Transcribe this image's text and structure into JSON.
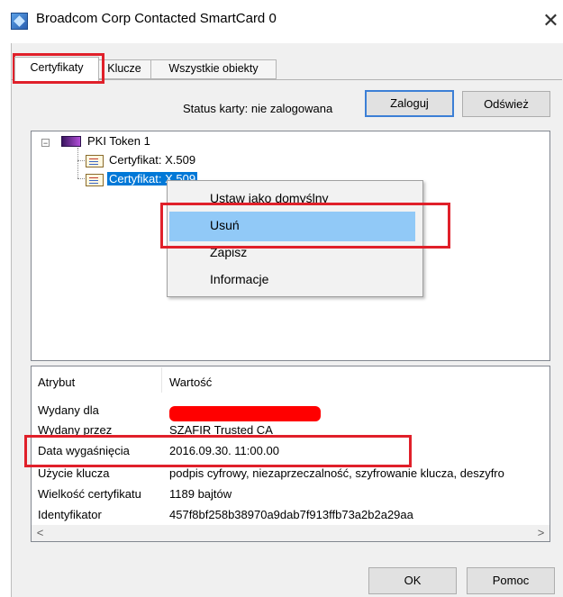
{
  "window": {
    "title": "Broadcom Corp Contacted SmartCard 0",
    "close_glyph": "✕"
  },
  "tabs": [
    "Certyfikaty",
    "Klucze",
    "Wszystkie obiekty"
  ],
  "toolbar": {
    "status_label": "Status karty: nie zalogowana",
    "login_button": "Zaloguj",
    "refresh_button": "Odśwież"
  },
  "tree": {
    "toggle_glyph": "−",
    "root_label": "PKI Token 1",
    "items": [
      "Certyfikat: X.509",
      "Certyfikat: X.509"
    ]
  },
  "context_menu": {
    "items": [
      "Ustaw jako domyślny",
      "Usuń",
      "Zapisz",
      "Informacje"
    ],
    "highlighted": "Usuń"
  },
  "details": {
    "columns": [
      "Atrybut",
      "Wartość"
    ],
    "rows": [
      {
        "attr": "Wydany dla",
        "value": ""
      },
      {
        "attr": "Wydany przez",
        "value": "SZAFIR Trusted CA"
      },
      {
        "attr": "Data wygaśnięcia",
        "value": "2016.09.30. 11:00.00"
      },
      {
        "attr": "Użycie klucza",
        "value": "podpis cyfrowy, niezaprzeczalność, szyfrowanie klucza, deszyfro"
      },
      {
        "attr": "Wielkość certyfikatu",
        "value": "1189 bajtów"
      },
      {
        "attr": "Identyfikator",
        "value": "457f8bf258b38970a9dab7f913ffb73a2b2a29aa"
      }
    ],
    "scroll_left": "<",
    "scroll_right": ">"
  },
  "footer": {
    "ok_button": "OK",
    "help_button": "Pomoc"
  },
  "colors": {
    "selection": "#0078d7",
    "menu_highlight": "#91c9f7",
    "annotation": "#e0202a",
    "redaction": "#ff0000"
  }
}
